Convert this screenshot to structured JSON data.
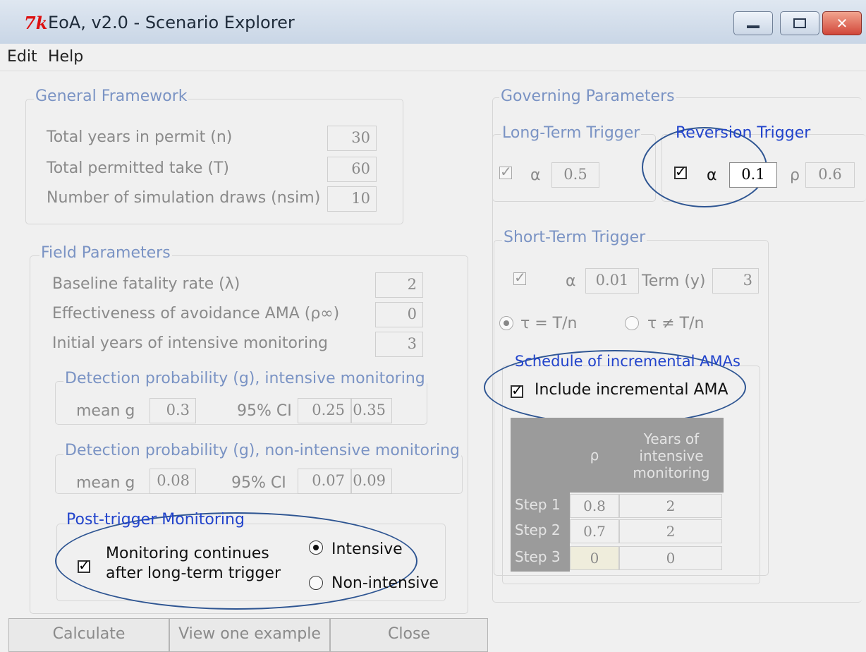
{
  "window": {
    "icon_glyph": "7k",
    "title": "EoA, v2.0 - Scenario Explorer",
    "controls": {
      "minimize": "minimize-icon",
      "maximize": "maximize-icon",
      "close_glyph": "✕"
    }
  },
  "menu": [
    {
      "label": "Edit"
    },
    {
      "label": "Help"
    }
  ],
  "general_framework": {
    "title": "General Framework",
    "rows": [
      {
        "label": "Total years in permit (n)",
        "value": "30"
      },
      {
        "label": "Total permitted take (T)",
        "value": "60"
      },
      {
        "label": "Number of simulation draws (nsim)",
        "value": "10"
      }
    ]
  },
  "field_parameters": {
    "title": "Field Parameters",
    "rows": [
      {
        "label": "Baseline fatality rate (λ)",
        "value": "2"
      },
      {
        "label": "Effectiveness of avoidance AMA (ρ∞)",
        "value": "0"
      },
      {
        "label": "Initial years of intensive monitoring",
        "value": "3"
      }
    ],
    "detection_intensive": {
      "title": "Detection probability (g), intensive monitoring",
      "mean_label": "mean g",
      "mean_value": "0.3",
      "ci_label": "95% CI",
      "ci_low": "0.25",
      "ci_high": "0.35"
    },
    "detection_nonintensive": {
      "title": "Detection probability (g), non-intensive monitoring",
      "mean_label": "mean g",
      "mean_value": "0.08",
      "ci_label": "95% CI",
      "ci_low": "0.07",
      "ci_high": "0.09"
    },
    "post_trigger": {
      "title": "Post-trigger Monitoring",
      "checkbox_line1": "Monitoring continues",
      "checkbox_line2": "after long-term trigger",
      "checked": true,
      "options": [
        {
          "label": "Intensive",
          "selected": true
        },
        {
          "label": "Non-intensive",
          "selected": false
        }
      ]
    }
  },
  "governing_parameters": {
    "title": "Governing Parameters",
    "long_term": {
      "title": "Long-Term Trigger",
      "checked": true,
      "alpha_label": "α",
      "alpha_value": "0.5"
    },
    "reversion": {
      "title": "Reversion Trigger",
      "checked": true,
      "alpha_label": "α",
      "alpha_value": "0.1",
      "rho_label": "ρ",
      "rho_value": "0.6"
    },
    "short_term": {
      "title": "Short-Term Trigger",
      "checked": true,
      "alpha_label": "α",
      "alpha_value": "0.01",
      "term_label": "Term (y)",
      "term_value": "3",
      "tau_options": [
        {
          "label": "τ = T/n",
          "selected": true
        },
        {
          "label": "τ ≠ T/n",
          "selected": false
        }
      ]
    },
    "schedule": {
      "title": "Schedule of incremental AMAs",
      "include_label": "Include incremental AMA",
      "include_checked": true,
      "col_rho": "ρ",
      "col_years_1": "Years of",
      "col_years_2": "intensive",
      "col_years_3": "monitoring",
      "rows": [
        {
          "step": "Step 1",
          "rho": "0.8",
          "years": "2"
        },
        {
          "step": "Step 2",
          "rho": "0.7",
          "years": "2"
        },
        {
          "step": "Step 3",
          "rho": "0",
          "years": "0"
        }
      ]
    }
  },
  "buttons": {
    "calculate": "Calculate",
    "example": "View one example",
    "close": "Close"
  }
}
